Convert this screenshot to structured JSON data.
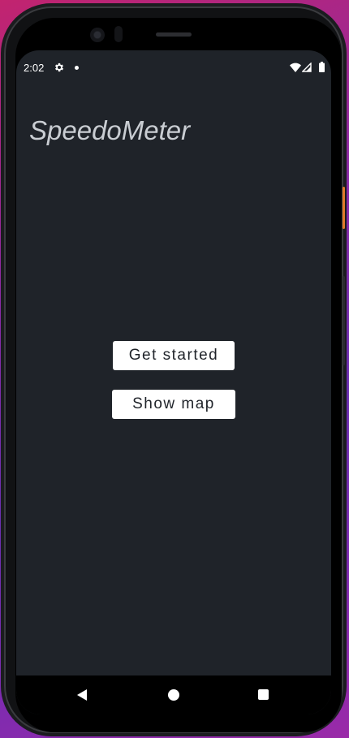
{
  "status_bar": {
    "time": "2:02",
    "icons": [
      "gear-icon",
      "dot-icon",
      "wifi-icon",
      "signal-icon",
      "battery-icon"
    ]
  },
  "app": {
    "title": "SpeedoMeter"
  },
  "buttons": {
    "get_started": "Get started",
    "show_map": "Show map"
  },
  "navigation": {
    "icons": [
      "back-icon",
      "home-icon",
      "recents-icon"
    ]
  },
  "colors": {
    "screen_background": "#1f2329",
    "button_background": "#ffffff",
    "title_text": "#c9cdd2"
  }
}
